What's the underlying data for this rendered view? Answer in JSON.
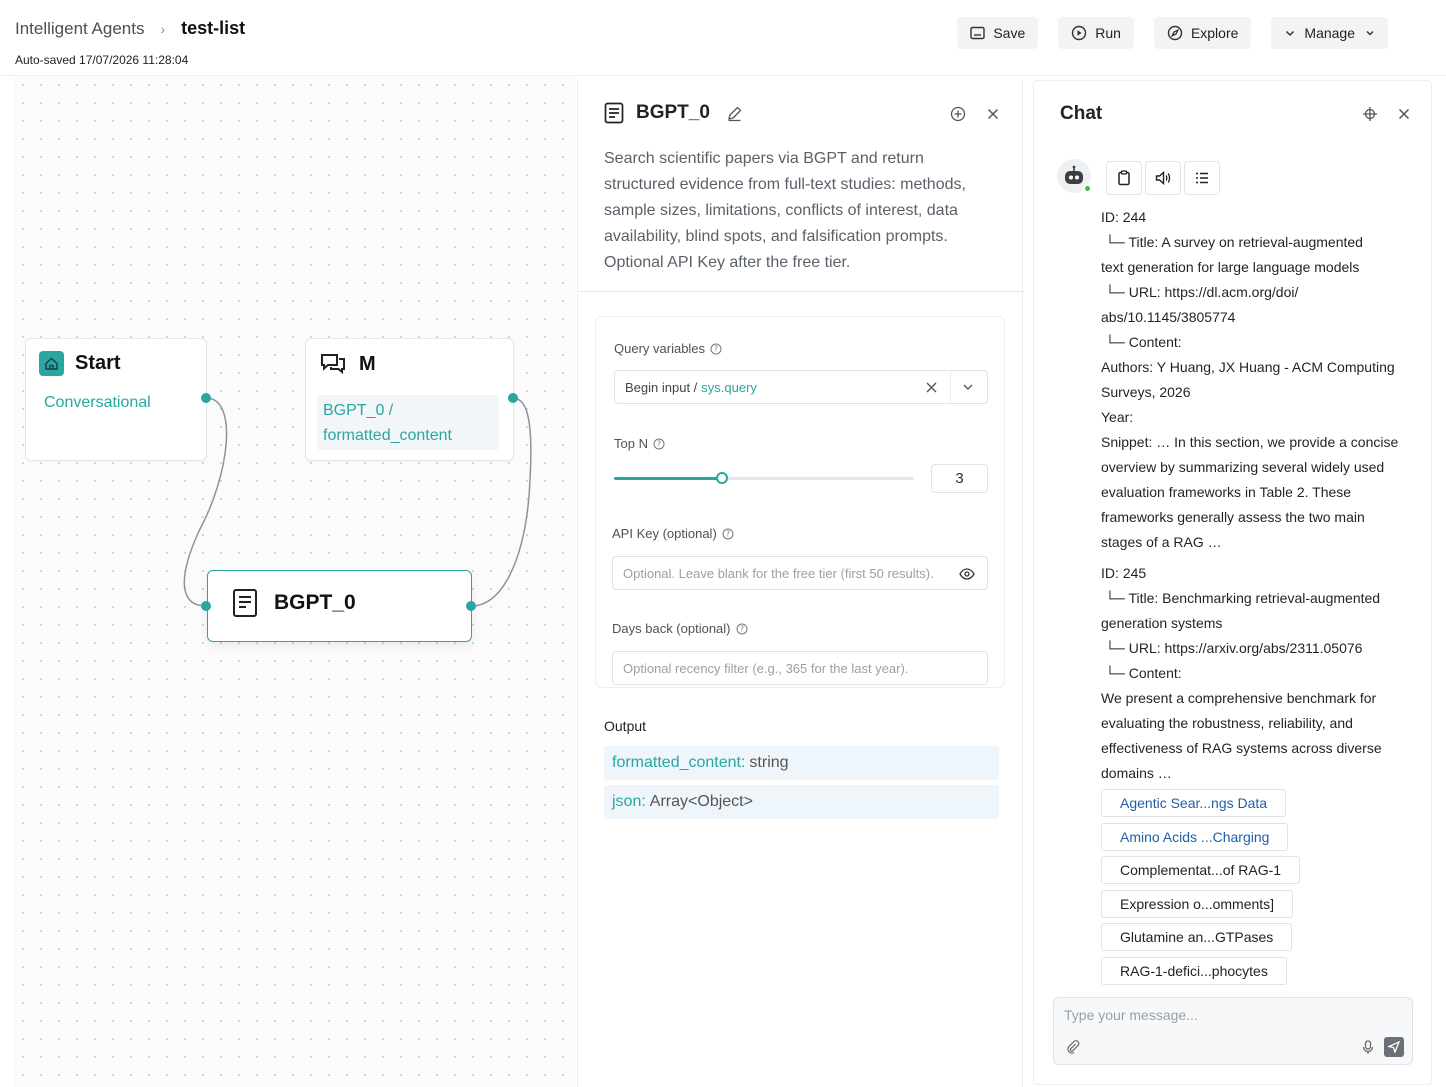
{
  "header": {
    "breadcrumb_root": "Intelligent Agents",
    "breadcrumb_current": "test-list",
    "autosave": "Auto-saved 17/07/2026 11:28:04",
    "save_label": "Save",
    "run_label": "Run",
    "explore_label": "Explore",
    "manage_label": "Manage"
  },
  "canvas": {
    "start_node": {
      "title": "Start",
      "subtitle": "Conversational"
    },
    "message_node": {
      "title": "M",
      "ref_line1": "BGPT_0 /",
      "ref_line2": "formatted_content"
    },
    "bgpt_node": {
      "title": "BGPT_0"
    }
  },
  "config": {
    "title": "BGPT_0",
    "description": "Search scientific papers via BGPT and return structured evidence from full-text studies: methods, sample sizes, limitations, conflicts of interest, data availability, blind spots, and falsification prompts. Optional API Key after the free tier.",
    "query_label": "Query variables",
    "query_prefix": "Begin input / ",
    "query_value": "sys.query",
    "topn_label": "Top N",
    "topn_value": "3",
    "topn_fraction": 0.36,
    "apikey_label": "API Key (optional)",
    "apikey_placeholder": "Optional. Leave blank for the free tier (first 50 results).",
    "days_label": "Days back (optional)",
    "days_placeholder": "Optional recency filter (e.g., 365 for the last year).",
    "output_label": "Output",
    "outputs": [
      {
        "name": "formatted_content:",
        "type": "string"
      },
      {
        "name": "json:",
        "type": "Array<Object>"
      }
    ]
  },
  "chat": {
    "title": "Chat",
    "lines": [
      "ID: 244",
      "  └─ Title: A survey on retrieval-augmented",
      "text generation for large language models",
      "  └─ URL: https://dl.acm.org/doi/",
      "abs/10.1145/3805774",
      "  └─ Content:",
      "Authors: Y Huang, JX Huang - ACM Computing",
      "Surveys, 2026",
      "Year:",
      "Snippet: … In this section, we provide a concise",
      "overview by summarizing several widely used",
      "evaluation frameworks in Table 2. These",
      "frameworks generally assess the two main",
      "stages of a RAG …",
      "ID: 245",
      "  └─ Title: Benchmarking retrieval-augmented",
      "generation systems",
      "  └─ URL: https://arxiv.org/abs/2311.05076",
      "  └─ Content:",
      "We present a comprehensive benchmark for",
      "evaluating the robustness, reliability, and",
      "effectiveness of RAG systems across diverse",
      "domains …"
    ],
    "chips": [
      "Agentic Sear...ngs Data",
      "Amino Acids ...Charging",
      "Complementat...of RAG-1",
      "Expression o...omments]",
      "Glutamine an...GTPases",
      "RAG-1-defici...phocytes"
    ],
    "input_placeholder": "Type your message..."
  },
  "colors": {
    "accent": "#2aa6a1",
    "link_blue": "#1f5fa8"
  }
}
